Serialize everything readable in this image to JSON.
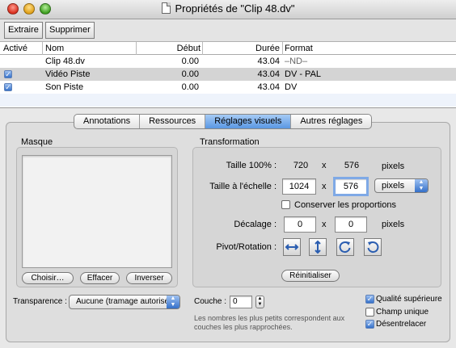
{
  "window": {
    "title": "Propriétés de \"Clip 48.dv\""
  },
  "toolbar": {
    "extract_label": "Extraire",
    "delete_label": "Supprimer"
  },
  "table": {
    "columns": [
      "Activé",
      "Nom",
      "Début",
      "Durée",
      "Format"
    ],
    "rows": [
      {
        "active": false,
        "name": "Clip 48.dv",
        "start": "0.00",
        "duration": "43.04",
        "format": "–ND–"
      },
      {
        "active": true,
        "name": "Vidéo Piste",
        "start": "0.00",
        "duration": "43.04",
        "format": "DV - PAL"
      },
      {
        "active": true,
        "name": "Son Piste",
        "start": "0.00",
        "duration": "43.04",
        "format": "DV"
      }
    ]
  },
  "tabs": [
    "Annotations",
    "Ressources",
    "Réglages visuels",
    "Autres réglages"
  ],
  "active_tab": "Réglages visuels",
  "mask": {
    "label": "Masque",
    "choose_label": "Choisir…",
    "clear_label": "Effacer",
    "invert_label": "Inverser"
  },
  "transformation": {
    "label": "Transformation",
    "size100_label": "Taille 100% :",
    "size100_width": "720",
    "size100_x": "x",
    "size100_height": "576",
    "size100_unit": "pixels",
    "scaled_label": "Taille à l'échelle :",
    "scaled_width": "1024",
    "scaled_x": "x",
    "scaled_height": "576",
    "scaled_unit": "pixels",
    "keep_proportions_label": "Conserver les proportions",
    "keep_proportions": false,
    "offset_label": "Décalage :",
    "offset_x": "0",
    "offset_sep": "x",
    "offset_y": "0",
    "offset_unit": "pixels",
    "pivot_label": "Pivot/Rotation :",
    "pivot_icons": [
      "flip-horizontal-icon",
      "flip-vertical-icon",
      "rotate-clockwise-icon",
      "rotate-counterclockwise-icon"
    ],
    "reset_label": "Réinitialiser"
  },
  "transparency": {
    "label": "Transparence :",
    "value": "Aucune (tramage autorisé)"
  },
  "layer": {
    "label": "Couche :",
    "value": "0",
    "hint": "Les nombres les plus petits correspondent aux couches les plus rapprochées."
  },
  "options": [
    {
      "label": "Qualité supérieure",
      "checked": true
    },
    {
      "label": "Champ unique",
      "checked": false
    },
    {
      "label": "Désentrelacer",
      "checked": true
    }
  ]
}
